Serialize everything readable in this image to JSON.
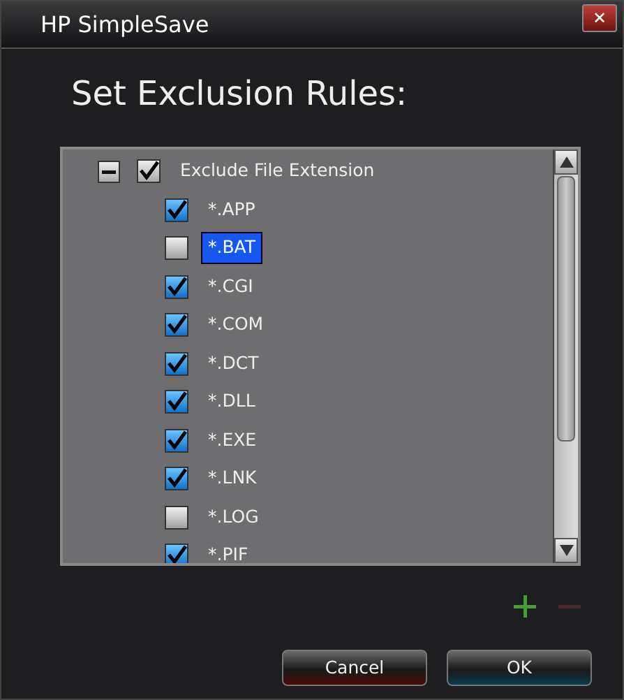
{
  "window": {
    "title": "HP SimpleSave",
    "close": "✕"
  },
  "heading": "Set Exclusion Rules:",
  "tree": {
    "label": "Exclude File Extension",
    "expanded": true,
    "checked": true,
    "children": [
      {
        "label": "*.APP",
        "checked": true,
        "selected": false
      },
      {
        "label": "*.BAT",
        "checked": false,
        "selected": true
      },
      {
        "label": "*.CGI",
        "checked": true,
        "selected": false
      },
      {
        "label": "*.COM",
        "checked": true,
        "selected": false
      },
      {
        "label": "*.DCT",
        "checked": true,
        "selected": false
      },
      {
        "label": "*.DLL",
        "checked": true,
        "selected": false
      },
      {
        "label": "*.EXE",
        "checked": true,
        "selected": false
      },
      {
        "label": "*.LNK",
        "checked": true,
        "selected": false
      },
      {
        "label": "*.LOG",
        "checked": false,
        "selected": false
      },
      {
        "label": "*.PIF",
        "checked": true,
        "selected": false
      }
    ]
  },
  "add_rule": {
    "disabled": false
  },
  "remove_rule": {
    "disabled": true
  },
  "buttons": [
    {
      "label": "Cancel",
      "kind": "cancel"
    },
    {
      "label": "OK",
      "kind": "ok"
    }
  ]
}
